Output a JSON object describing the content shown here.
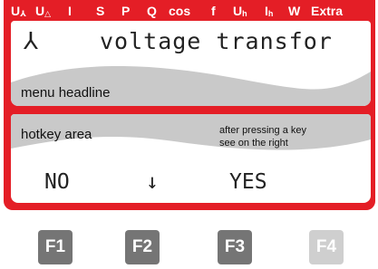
{
  "menu_bar": {
    "items": [
      {
        "main": "U",
        "sub": "⅄"
      },
      {
        "main": "U",
        "sub": "△"
      },
      {
        "main": "I",
        "sub": ""
      },
      {
        "main": "S",
        "sub": ""
      },
      {
        "main": "P",
        "sub": ""
      },
      {
        "main": "Q",
        "sub": ""
      },
      {
        "main": "cos",
        "sub": ""
      },
      {
        "main": "f",
        "sub": ""
      },
      {
        "main": "U",
        "sub": "h"
      },
      {
        "main": "I",
        "sub": "h"
      },
      {
        "main": "W",
        "sub": ""
      },
      {
        "main": "Extra",
        "sub": ""
      }
    ]
  },
  "display": {
    "star_symbol": "⅄",
    "menu_text": "voltage transfor",
    "menu_headline_label": "menu headline"
  },
  "hotkeys": {
    "area_label": "hotkey area",
    "hint_line1": "after pressing a key",
    "hint_line2": "see on the right",
    "labels": [
      "NO",
      "↓",
      "YES"
    ]
  },
  "function_keys": [
    {
      "label": "F1",
      "color": "#757575"
    },
    {
      "label": "F2",
      "color": "#757575"
    },
    {
      "label": "F3",
      "color": "#757575"
    },
    {
      "label": "F4",
      "color": "#cfcfcf"
    }
  ],
  "colors": {
    "frame_red": "#e41e26",
    "wave_gray": "#c9c9c9"
  }
}
